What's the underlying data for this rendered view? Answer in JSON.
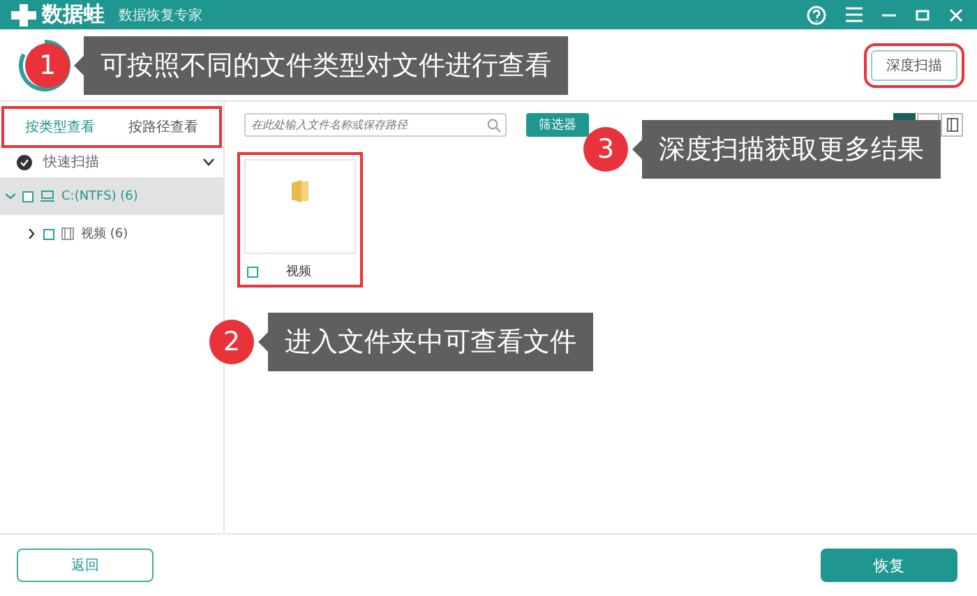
{
  "window": {
    "app_name": "数据蛙",
    "subtitle": "数据恢复专家"
  },
  "header": {
    "deep_scan_button": "深度扫描"
  },
  "view_tabs": [
    {
      "label": "按类型查看",
      "selected": true
    },
    {
      "label": "按路径查看",
      "selected": false
    }
  ],
  "scan_section": {
    "label": "快速扫描",
    "expanded": true
  },
  "tree": [
    {
      "label": "C:(NTFS) (6)",
      "expanded": true,
      "checked": false,
      "selected": true,
      "children": [
        {
          "label": "视频 (6)",
          "expanded": false,
          "checked": false,
          "selected": false
        }
      ]
    }
  ],
  "search": {
    "placeholder": "在此处输入文件名称或保存路径"
  },
  "filter_button": "筛选器",
  "view_modes": [
    {
      "kind": "grid",
      "selected": true
    },
    {
      "kind": "list",
      "selected": false
    },
    {
      "kind": "detail",
      "selected": false
    }
  ],
  "files": [
    {
      "name": "视频",
      "checked": false
    }
  ],
  "footer": {
    "back_button": "返回",
    "recover_button": "恢复"
  },
  "callouts": [
    {
      "number": "1",
      "text": "可按照不同的文件类型对文件进行查看"
    },
    {
      "number": "2",
      "text": "进入文件夹中可查看文件"
    },
    {
      "number": "3",
      "text": "深度扫描获取更多结果"
    }
  ]
}
